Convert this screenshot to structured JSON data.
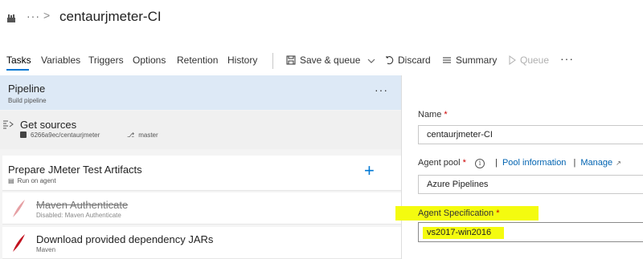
{
  "header": {
    "breadcrumb_more": "···",
    "breadcrumb_sep": ">",
    "title": "centaurjmeter-CI"
  },
  "toolbar": {
    "tabs": [
      "Tasks",
      "Variables",
      "Triggers",
      "Options",
      "Retention",
      "History"
    ],
    "active_tab": "Tasks",
    "save_queue": "Save & queue",
    "discard": "Discard",
    "summary": "Summary",
    "queue": "Queue",
    "more": "···"
  },
  "pipeline": {
    "title": "Pipeline",
    "subtitle": "Build pipeline",
    "more": "···"
  },
  "get_sources": {
    "title": "Get sources",
    "repo": "6266a9ec/centaurjmeter",
    "branch": "master"
  },
  "phase": {
    "title": "Prepare JMeter Test Artifacts",
    "subtitle": "Run on agent",
    "add": "+"
  },
  "tasks": [
    {
      "title": "Maven Authenticate",
      "subtitle": "Disabled: Maven Authenticate",
      "disabled": true
    },
    {
      "title": "Download provided dependency JARs",
      "subtitle": "Maven",
      "disabled": false
    }
  ],
  "form": {
    "name_label": "Name",
    "name_value": "centaurjmeter-CI",
    "pool_label": "Agent pool",
    "pool_info_link": "Pool information",
    "pool_manage_link": "Manage",
    "pool_value": "Azure Pipelines",
    "spec_label": "Agent Specification",
    "spec_value": "vs2017-win2016",
    "required_mark": "*",
    "link_sep": "|"
  },
  "colors": {
    "accent": "#0078d4",
    "selection": "#dde9f6",
    "highlight": "#f4fb0f"
  }
}
